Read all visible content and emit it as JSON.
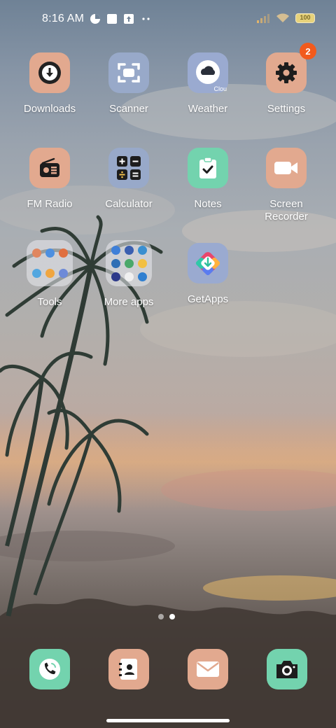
{
  "status_bar": {
    "time": "8:16 AM",
    "battery": "100"
  },
  "apps": [
    {
      "label": "Downloads",
      "icon": "download-icon"
    },
    {
      "label": "Scanner",
      "icon": "scanner-icon"
    },
    {
      "label": "Weather",
      "icon": "weather-icon",
      "sublabel": "Clou"
    },
    {
      "label": "Settings",
      "icon": "gear-icon",
      "badge": "2"
    },
    {
      "label": "FM Radio",
      "icon": "radio-icon"
    },
    {
      "label": "Calculator",
      "icon": "calculator-icon"
    },
    {
      "label": "Notes",
      "icon": "notes-icon"
    },
    {
      "label": "Screen\nRecorder",
      "icon": "video-camera-icon"
    },
    {
      "label": "Tools",
      "icon": "folder-icon"
    },
    {
      "label": "More apps",
      "icon": "folder-icon"
    },
    {
      "label": "GetApps",
      "icon": "getapps-icon"
    }
  ],
  "page_indicator": {
    "pages": 2,
    "active": 2
  },
  "dock": [
    {
      "icon": "phone-icon"
    },
    {
      "icon": "contacts-icon"
    },
    {
      "icon": "mail-icon"
    },
    {
      "icon": "camera-icon"
    }
  ],
  "colors": {
    "peach": "#e2a98f",
    "blue": "#98a9c9",
    "green": "#73d3ae",
    "badge": "#f25a1c"
  }
}
